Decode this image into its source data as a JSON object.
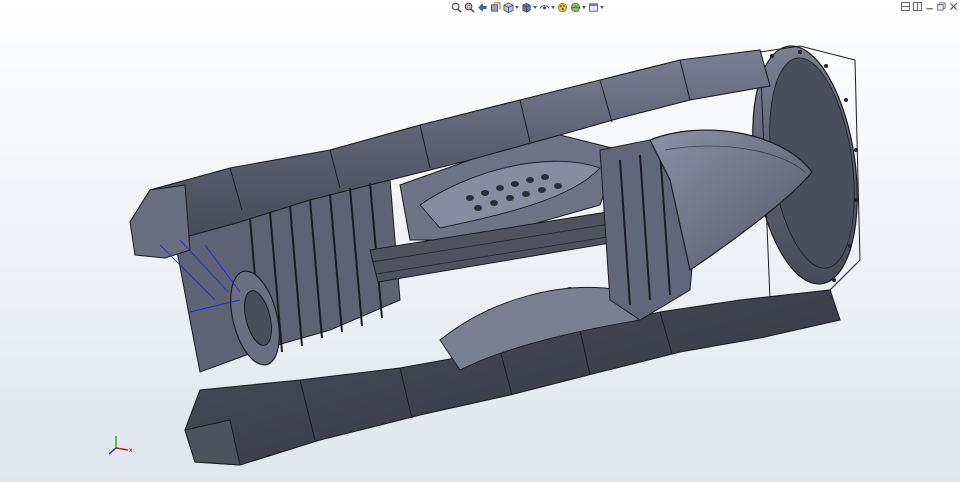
{
  "window": {
    "title": ""
  },
  "heads_up_toolbar": {
    "icons": [
      "zoom-to-fit-icon",
      "zoom-to-area-icon",
      "previous-view-icon",
      "section-view-icon",
      "view-orientation-icon",
      "display-style-icon",
      "hide-show-items-icon",
      "edit-appearance-icon",
      "apply-scene-icon",
      "view-settings-icon"
    ]
  },
  "window_controls": {
    "icons": [
      "tile-horizontal-icon",
      "tile-vertical-icon",
      "minimize-icon",
      "restore-icon",
      "close-icon"
    ]
  },
  "colors": {
    "background_top": "#ffffff",
    "background_bottom": "#dfe5ee",
    "model_fill": "#5b5f70",
    "model_light": "#767b8e",
    "model_dark": "#3c3f4c",
    "edge": "#1b1c22",
    "selection": "#1a2fd6"
  },
  "triad": {
    "x_label": "x",
    "y_label": "y",
    "z_label": "z"
  }
}
